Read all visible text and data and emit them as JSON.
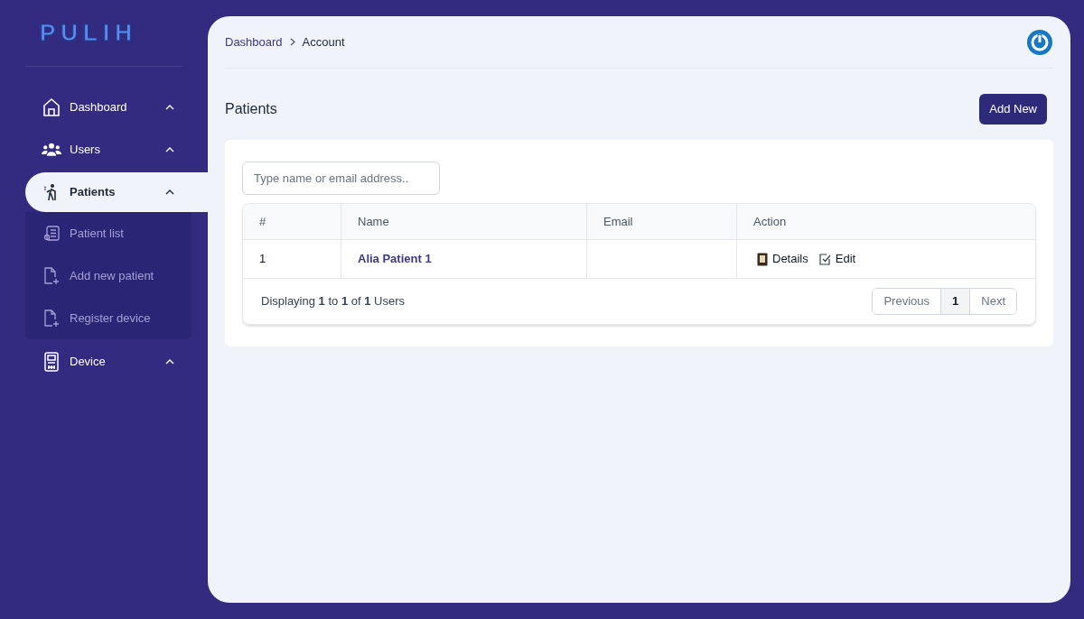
{
  "logo": "PULIH",
  "sidebar": {
    "items": [
      {
        "label": "Dashboard",
        "kind": "home",
        "selected": false
      },
      {
        "label": "Users",
        "kind": "users",
        "selected": false
      },
      {
        "label": "Patients",
        "kind": "walker",
        "selected": true,
        "children": [
          {
            "label": "Patient list",
            "kind": "list"
          },
          {
            "label": "Add new patient",
            "kind": "file"
          },
          {
            "label": "Register device",
            "kind": "file"
          }
        ]
      },
      {
        "label": "Device",
        "kind": "device",
        "selected": false
      }
    ]
  },
  "breadcrumb": [
    "Dashboard",
    "Account"
  ],
  "page_title": "Patients",
  "add_button": "Add New",
  "search": {
    "placeholder": "Type name or email address.."
  },
  "table": {
    "columns": [
      "#",
      "Name",
      "Email",
      "Action"
    ],
    "rows": [
      {
        "number": "1",
        "name": "Alia Patient 1",
        "actions": [
          {
            "kind": "details",
            "label": "Details"
          },
          {
            "kind": "edit",
            "label": "Edit"
          }
        ]
      }
    ]
  },
  "footer": {
    "summary": "Displaying **1** to **1** of **1** Users",
    "pages": [
      {
        "label": "Previous",
        "selected": false
      },
      {
        "label": "1",
        "selected": true
      },
      {
        "label": "Next",
        "selected": false
      }
    ]
  }
}
